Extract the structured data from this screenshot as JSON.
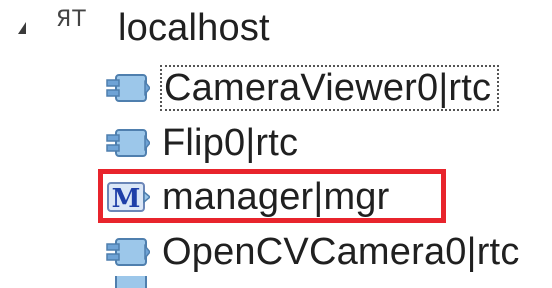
{
  "tree": {
    "root": {
      "label": "localhost",
      "icon": "naming-server-icon",
      "icon_glyph": "ЯТ",
      "expanded": true
    },
    "children": [
      {
        "label": "CameraViewer0|rtc",
        "icon": "rtc-component-icon",
        "focused": true
      },
      {
        "label": "Flip0|rtc",
        "icon": "rtc-component-icon"
      },
      {
        "label": "manager|mgr",
        "icon": "manager-icon",
        "highlighted": true
      },
      {
        "label": "OpenCVCamera0|rtc",
        "icon": "rtc-component-icon"
      }
    ]
  },
  "colors": {
    "highlight_border": "#e8242c",
    "component_icon_fill": "#9cc7ea",
    "manager_icon_fill": "#1f3fa8"
  }
}
